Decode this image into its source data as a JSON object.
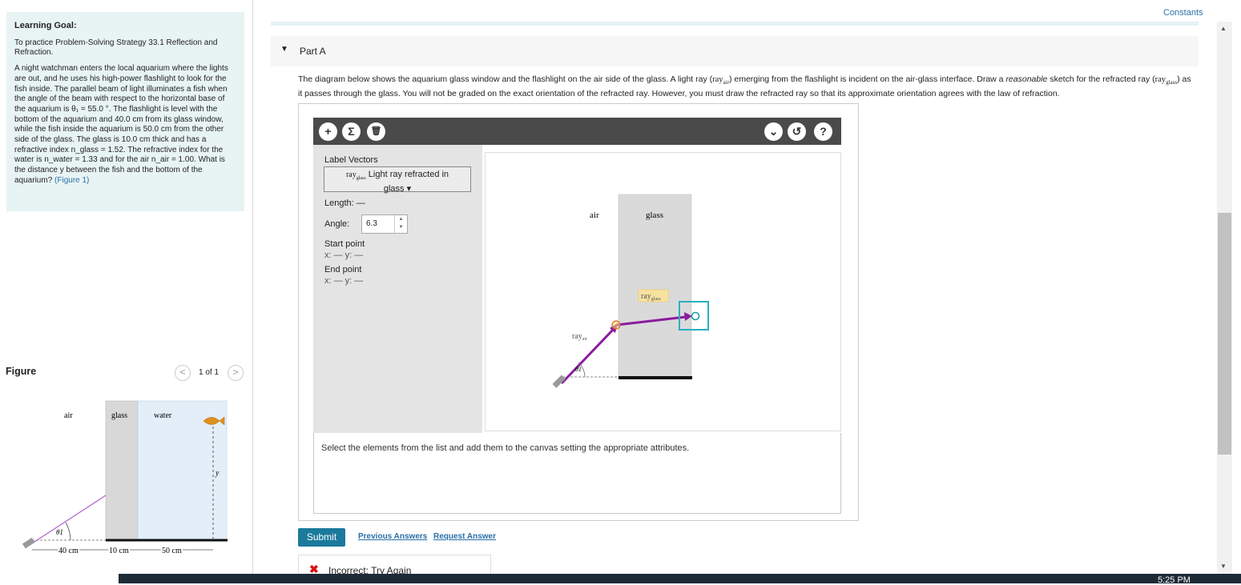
{
  "left": {
    "goal": {
      "title": "Learning Goal:",
      "text1": "To practice Problem-Solving Strategy 33.1 Reflection and Refraction.",
      "problem": "A night watchman enters the local aquarium where the lights are out, and he uses his high-power flashlight to look for the fish inside. The parallel beam of light illuminates a fish when the angle of the beam with respect to the horizontal base of the aquarium is θ₁ = 55.0 °. The flashlight is level with the bottom of the aquarium and 40.0 cm from its glass window, while the fish inside the aquarium is 50.0 cm from the other side of the glass. The glass is 10.0 cm thick and has a refractive index n_glass = 1.52. The refractive index for the water is n_water = 1.33 and for the air n_air = 1.00. What is the distance y between the fish and the bottom of the aquarium?",
      "figure_link": "(Figure 1)"
    },
    "figure": {
      "title": "Figure",
      "prev": "<",
      "next": ">",
      "count": "1 of 1",
      "labels": {
        "air": "air",
        "glass": "glass",
        "water": "water",
        "y": "y",
        "theta": "θ1"
      },
      "dims": {
        "d1": "40 cm",
        "d2": "10 cm",
        "d3": "50 cm"
      }
    }
  },
  "header": {
    "constants": "Constants",
    "part_title": "Part A"
  },
  "question": {
    "t1": "The diagram below shows the aquarium glass window and the flashlight on the air side of the glass. A light ray (",
    "ray": "ray",
    "air_sub": "air",
    "t2": ") emerging from the flashlight is incident on the air-glass interface. Draw a",
    "reasonable": "reasonable",
    "t3": "sketch for the refracted ray (",
    "glass_sub": "glass",
    "t4": ") as it passes through the glass. You will not be graded on the exact orientation of the refracted ray. However, you must draw the refracted ray so that its approximate orientation agrees with the law of refraction."
  },
  "tool": {
    "toolbar": {
      "add": "+",
      "sigma": "Σ",
      "delete": "🗑",
      "chevron": "⌄",
      "reset": "↺",
      "help": "?"
    },
    "palette": {
      "label_vectors": "Label Vectors",
      "selected_ray": "ray",
      "selected_sub": "glass",
      "selected_name": "Light ray refracted in",
      "selected_name2": "glass ▾",
      "length_label": "Length: —",
      "angle_label": "Angle:",
      "angle_value": "6.3",
      "start_label": "Start point",
      "start_xy": "x: — y: —",
      "end_label": "End point",
      "end_xy": "x: — y: —"
    },
    "canvas": {
      "air": "air",
      "glass": "glass",
      "ray_air": "ray",
      "ray_air_sub": "air",
      "ray_glass": "ray",
      "ray_glass_sub": "glass",
      "theta": "θ1"
    },
    "instructions": "Select the elements from the list and add them to the canvas setting the appropriate attributes."
  },
  "actions": {
    "submit": "Submit",
    "previous": "Previous Answers",
    "request": "Request Answer"
  },
  "feedback": {
    "icon": "✖",
    "text": "Incorrect; Try Again"
  },
  "taskbar": {
    "clock": "5:25 PM"
  },
  "colors": {
    "accent": "#1b7a9b",
    "ray": "#8a1c9e",
    "goal_bg": "#e8f4f4",
    "error": "#dd1111"
  }
}
